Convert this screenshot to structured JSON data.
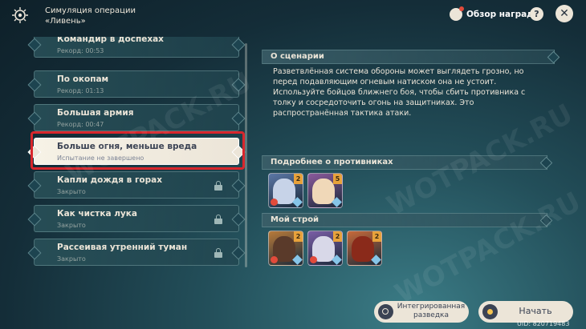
{
  "header": {
    "title_line1": "Симуляция операции",
    "title_line2": "«Ливень»",
    "rewards_label": "Обзор наград",
    "help_label": "?",
    "close_label": "✕"
  },
  "scenarios": [
    {
      "name": "Командир в доспехах",
      "status": "Рекорд: 00:53",
      "locked": false,
      "selected": false
    },
    {
      "name": "По окопам",
      "status": "Рекорд: 01:13",
      "locked": false,
      "selected": false
    },
    {
      "name": "Большая армия",
      "status": "Рекорд: 00:47",
      "locked": false,
      "selected": false
    },
    {
      "name": "Больше огня, меньше вреда",
      "status": "Испытание не завершено",
      "locked": false,
      "selected": true
    },
    {
      "name": "Капли дождя в горах",
      "status": "Закрыто",
      "locked": true,
      "selected": false
    },
    {
      "name": "Как чистка лука",
      "status": "Закрыто",
      "locked": true,
      "selected": false
    },
    {
      "name": "Рассеивая утренний туман",
      "status": "Закрыто",
      "locked": true,
      "selected": false
    }
  ],
  "scenario_info": {
    "heading": "О сценарии",
    "text": "Разветвлённая система обороны может выглядеть грозно, но перед подавляющим огневым натиском она не устоит. Используйте бойцов ближнего боя, чтобы сбить противника с толку и сосредоточить огонь на защитниках. Это распространённая тактика атаки."
  },
  "enemies": {
    "heading": "Подробнее о противниках",
    "cards": [
      {
        "level": "2",
        "icon": "ice-knight-icon",
        "bg": "#5b77a6",
        "art": "#c7d3e8",
        "elem": "#e24b3b",
        "weap": "#86c5e8"
      },
      {
        "level": "5",
        "icon": "hooded-enemy-icon",
        "bg": "#8a5a9c",
        "art": "#f0d8b8",
        "elem": "",
        "weap": "#86c5e8"
      }
    ]
  },
  "team": {
    "heading": "Мой строй",
    "cards": [
      {
        "level": "2",
        "icon": "dark-mech-icon",
        "bg": "#b87a3a",
        "art": "#5a3a2a",
        "elem": "#e24b3b",
        "weap": "#86c5e8"
      },
      {
        "level": "2",
        "icon": "frost-creature-icon",
        "bg": "#7a5ea6",
        "art": "#d8d8e8",
        "elem": "#e24b3b",
        "weap": "#86c5e8"
      },
      {
        "level": "2",
        "icon": "fire-mech-icon",
        "bg": "#c86a3a",
        "art": "#8a2a1a",
        "elem": "",
        "weap": "#86c5e8"
      }
    ]
  },
  "buttons": {
    "intel_label": "Интегрированная разведка",
    "start_label": "Начать"
  },
  "uid": "UID: 820719483",
  "watermarks": [
    "WOTPACK.RU",
    "WOTPACK.RU",
    "WOTPACK.RU"
  ]
}
